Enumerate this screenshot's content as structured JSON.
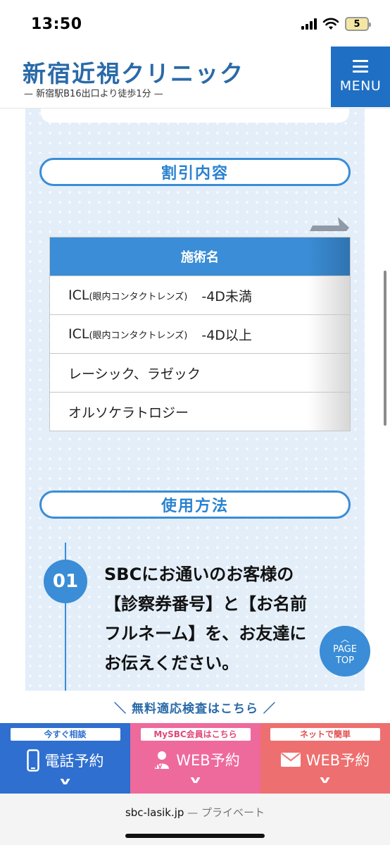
{
  "status": {
    "time": "13:50",
    "battery": "5"
  },
  "header": {
    "logo_title": "新宿近視クリニック",
    "logo_subtitle": "— 新宿駅B16出口より徒歩1分 —",
    "menu_label": "MENU"
  },
  "discount": {
    "heading": "割引内容",
    "table_header": "施術名",
    "rows": [
      {
        "name": "ICL",
        "note": "(眼内コンタクトレンズ)",
        "value": "-4D未満"
      },
      {
        "name": "ICL",
        "note": "(眼内コンタクトレンズ)",
        "value": "-4D以上"
      },
      {
        "name": "レーシック、ラゼック",
        "note": "",
        "value": ""
      },
      {
        "name": "オルソケラトロジー",
        "note": "",
        "value": ""
      }
    ]
  },
  "usage": {
    "heading": "使用方法",
    "step_number": "01",
    "step_text": "SBCにお通いのお客様の【診察券番号】と【お名前フルネーム】を、お友達にお伝えください。"
  },
  "page_top": {
    "line1": "PAGE",
    "line2": "TOP"
  },
  "cta": {
    "banner": "＼ 無料適応検査はこちら ／",
    "phone": {
      "tag": "今すぐ相談",
      "label": "電話予約",
      "color": "#2f6fcf"
    },
    "mysbc": {
      "tag": "MySBC会員はこちら",
      "label": "WEB予約",
      "badge": "My",
      "color": "#ee6a9c"
    },
    "net": {
      "tag": "ネットで簡単",
      "label": "WEB予約",
      "color": "#ee6f6f"
    }
  },
  "browser": {
    "url": "sbc-lasik.jp",
    "mode": "— プライベート"
  },
  "colors": {
    "brand_blue": "#3a8dd6",
    "menu_blue": "#1f6fc4",
    "logo_blue": "#2a6aa8"
  }
}
